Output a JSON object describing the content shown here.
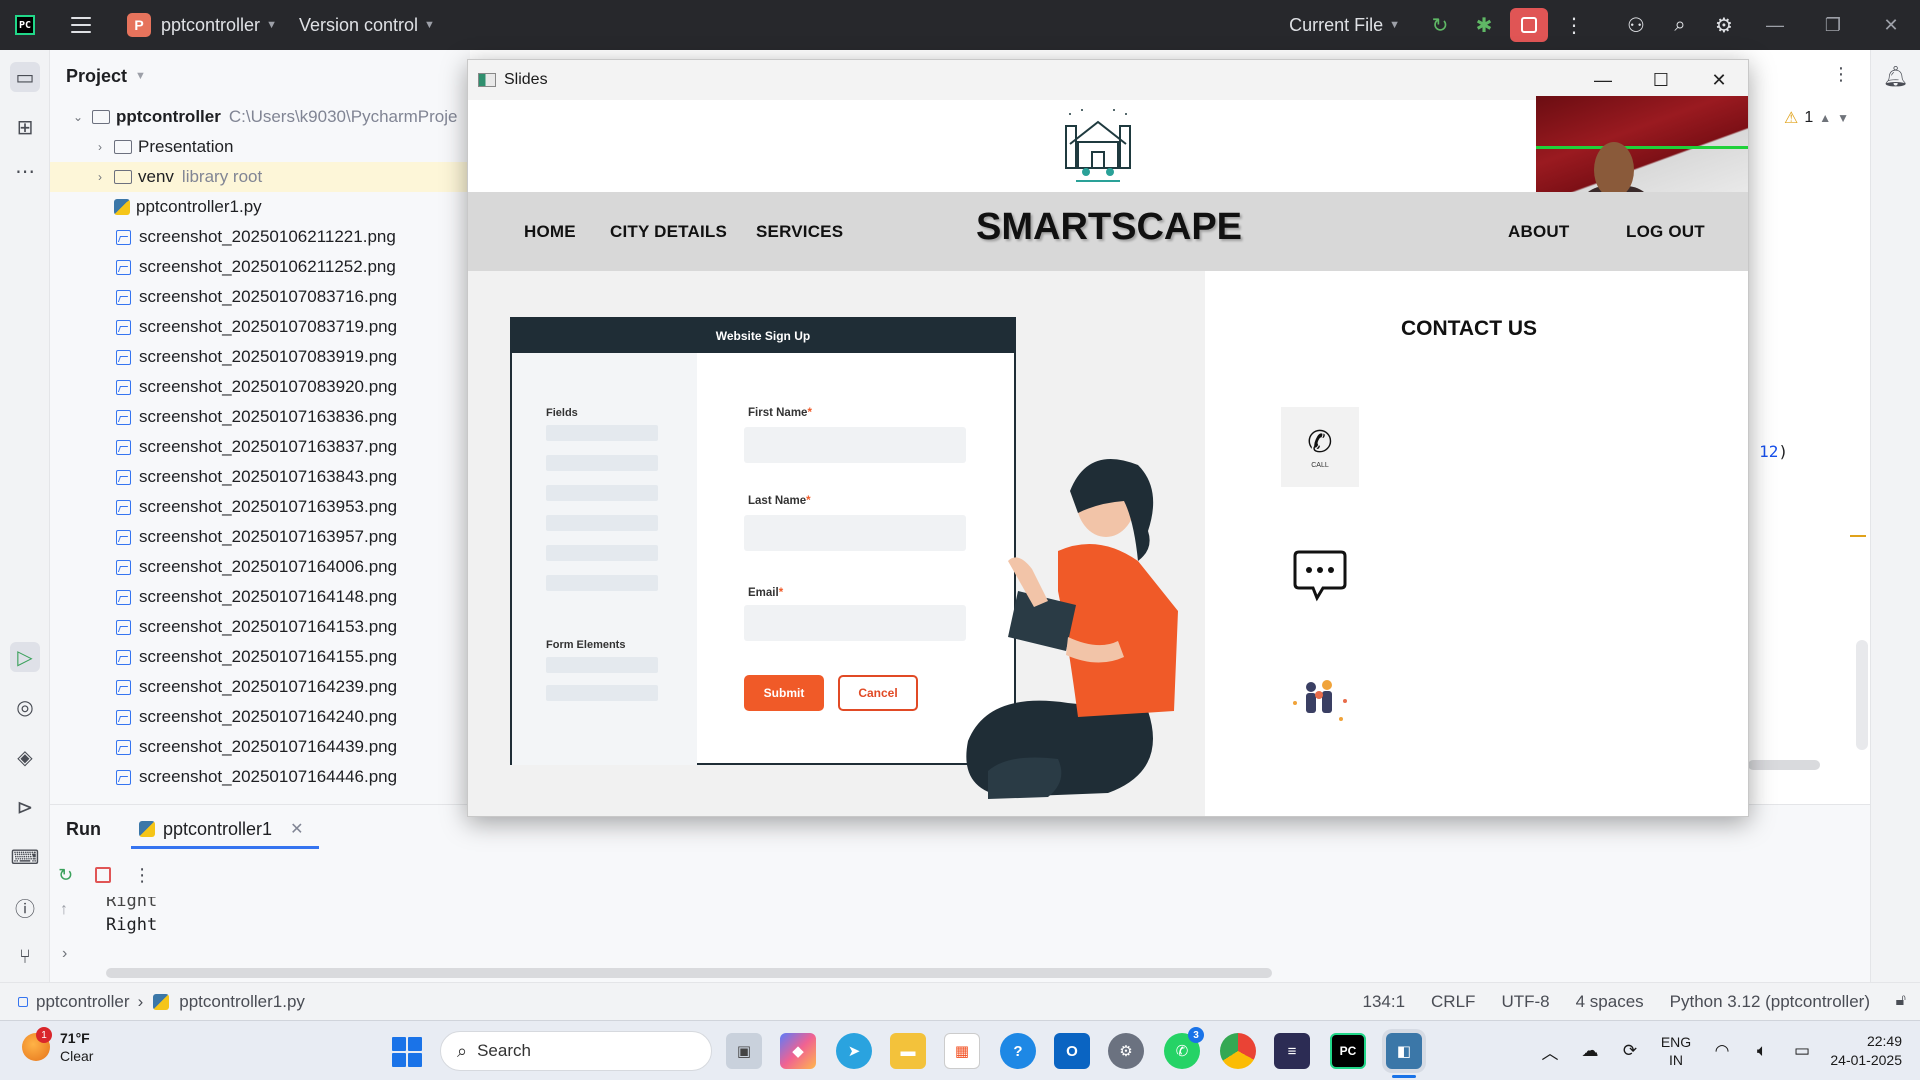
{
  "ide": {
    "logo": "PC",
    "project_badge": "P",
    "project_name": "pptcontroller",
    "version_control": "Version control",
    "run_config": "Current File",
    "accent": "#3574f0"
  },
  "project_panel": {
    "title": "Project",
    "root": {
      "name": "pptcontroller",
      "path": "C:\\Users\\k9030\\PycharmProje"
    },
    "folders": [
      {
        "name": "Presentation",
        "note": ""
      },
      {
        "name": "venv",
        "note": "library root"
      }
    ],
    "files": [
      "pptcontroller1.py",
      "screenshot_20250106211221.png",
      "screenshot_20250106211252.png",
      "screenshot_20250107083716.png",
      "screenshot_20250107083719.png",
      "screenshot_20250107083919.png",
      "screenshot_20250107083920.png",
      "screenshot_20250107163836.png",
      "screenshot_20250107163837.png",
      "screenshot_20250107163843.png",
      "screenshot_20250107163953.png",
      "screenshot_20250107163957.png",
      "screenshot_20250107164006.png",
      "screenshot_20250107164148.png",
      "screenshot_20250107164153.png",
      "screenshot_20250107164155.png",
      "screenshot_20250107164239.png",
      "screenshot_20250107164240.png",
      "screenshot_20250107164439.png",
      "screenshot_20250107164446.png"
    ]
  },
  "editor": {
    "warning_count": "1",
    "code_fragment_num": "12",
    "code_fragment_paren": ")"
  },
  "run_panel": {
    "title": "Run",
    "tab": "pptcontroller1",
    "console_lines": [
      "Right",
      "Right"
    ]
  },
  "status_bar": {
    "crumb_project": "pptcontroller",
    "crumb_file": "pptcontroller1.py",
    "position": "134:1",
    "line_sep": "CRLF",
    "encoding": "UTF-8",
    "indent": "4 spaces",
    "interpreter": "Python 3.12 (pptcontroller)"
  },
  "slides_window": {
    "title": "Slides",
    "site": {
      "brand": "SMARTSCAPE",
      "nav_left": [
        "HOME",
        "CITY DETAILS",
        "SERVICES"
      ],
      "nav_right": [
        "ABOUT",
        "LOG OUT"
      ],
      "contact_title": "CONTACT US",
      "call_caption": "CALL",
      "form": {
        "header": "Website Sign Up",
        "side_fields": "Fields",
        "side_form_elements": "Form Elements",
        "first_name": "First Name",
        "last_name": "Last Name",
        "email": "Email",
        "required_mark": "*",
        "submit": "Submit",
        "cancel": "Cancel",
        "accent": "#f05a28"
      }
    }
  },
  "taskbar": {
    "weather_temp": "71°F",
    "weather_desc": "Clear",
    "weather_badge": "1",
    "search_placeholder": "Search",
    "whatsapp_badge": "3",
    "lang_top": "ENG",
    "lang_bottom": "IN",
    "time": "22:49",
    "date": "24-01-2025"
  }
}
